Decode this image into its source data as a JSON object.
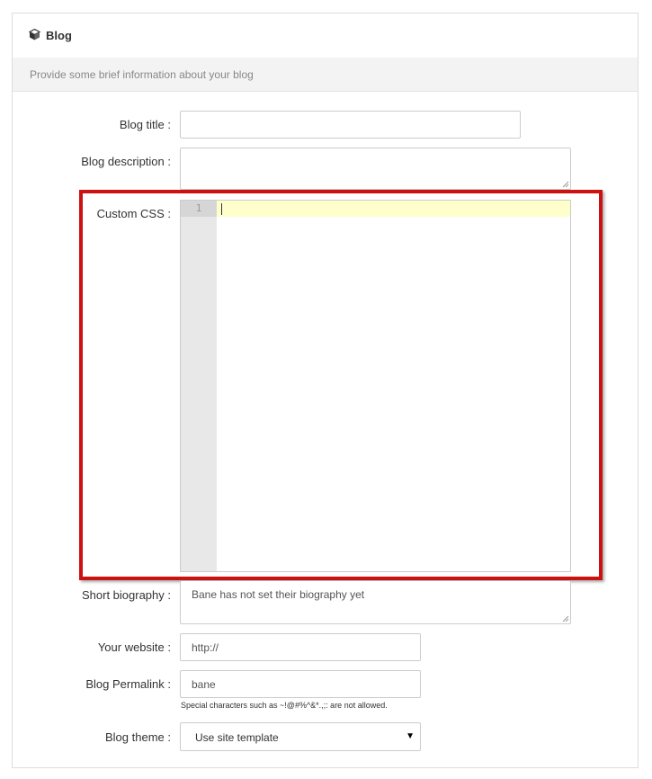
{
  "panel": {
    "title": "Blog",
    "title_icon": "cube-icon",
    "subtitle": "Provide some brief information about your blog"
  },
  "form": {
    "blog_title": {
      "label": "Blog title :",
      "value": ""
    },
    "blog_description": {
      "label": "Blog description :",
      "value": ""
    },
    "custom_css": {
      "label": "Custom CSS :",
      "line_number": "1",
      "value": ""
    },
    "short_biography": {
      "label": "Short biography :",
      "value": "Bane has not set their biography yet"
    },
    "website": {
      "label": "Your website :",
      "value": "http://"
    },
    "permalink": {
      "label": "Blog Permalink :",
      "value": "bane",
      "hint": "Special characters such as ~!@#%^&*.,;: are not allowed."
    },
    "theme": {
      "label": "Blog theme :",
      "selected": "Use site template"
    }
  },
  "colors": {
    "highlight_border": "#cc1111",
    "active_line": "#ffffcc",
    "gutter": "#e8e8e8"
  }
}
